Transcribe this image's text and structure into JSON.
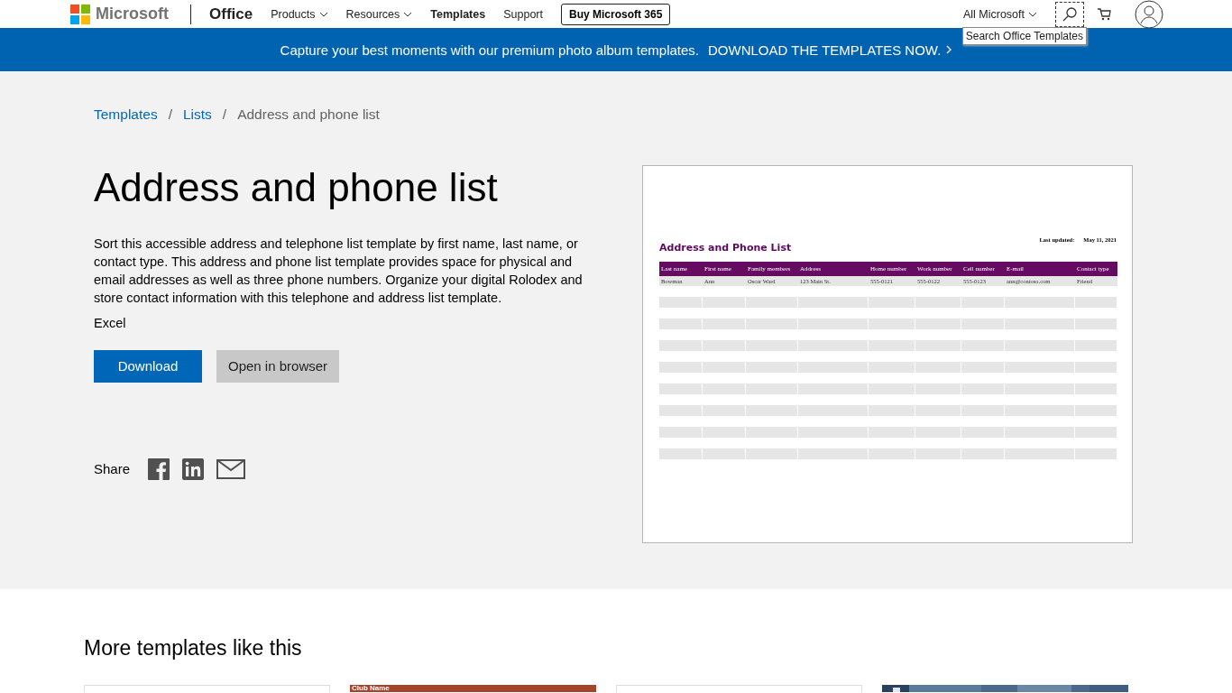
{
  "header": {
    "brand": "Microsoft",
    "product": "Office",
    "nav": [
      {
        "label": "Products",
        "dropdown": true
      },
      {
        "label": "Resources",
        "dropdown": true
      },
      {
        "label": "Templates",
        "dropdown": false
      },
      {
        "label": "Support",
        "dropdown": false
      }
    ],
    "cta": "Buy Microsoft 365",
    "scope": "All Microsoft",
    "tooltip": "Search Office Templates"
  },
  "banner": {
    "text": "Capture your best moments with our premium photo album templates.",
    "link": "DOWNLOAD THE TEMPLATES NOW."
  },
  "breadcrumb_separator": "/",
  "breadcrumb": [
    {
      "label": "Templates",
      "kind": "link"
    },
    {
      "label": "Lists",
      "kind": "link"
    },
    {
      "label": "Address and phone list",
      "kind": "current"
    }
  ],
  "title": "Address and phone list",
  "description": "Sort this accessible address and telephone list template by first name, last name, or contact type. This address and phone list template provides space for physical and email addresses as well as three phone numbers. Organize your digital Rolodex and store contact information with this telephone and address list template.",
  "app": "Excel",
  "buttons": [
    {
      "label": "Download",
      "kind": "primary"
    },
    {
      "label": "Open in browser",
      "kind": "secondary"
    }
  ],
  "share": "Share",
  "preview": {
    "title": "Address and Phone List",
    "updated_label": "Last updated:",
    "updated_value": "May 11, 2021",
    "columns": [
      "Last name",
      "First name",
      "Family members",
      "Address",
      "Home number",
      "Work number",
      "Cell number",
      "E-mail",
      "Contact type"
    ],
    "rows": [
      [
        "Bowman",
        "Ann",
        "Oscar Ward",
        "123 Main St.",
        "555-0121",
        "555-0122",
        "555-0123",
        "ann@contoso.com",
        "Friend"
      ]
    ]
  },
  "more": {
    "heading": "More templates like this",
    "cards": [
      {
        "kind": "blank"
      },
      {
        "kind": "club",
        "text": "Club Name"
      },
      {
        "kind": "blank"
      },
      {
        "kind": "picture"
      }
    ]
  }
}
